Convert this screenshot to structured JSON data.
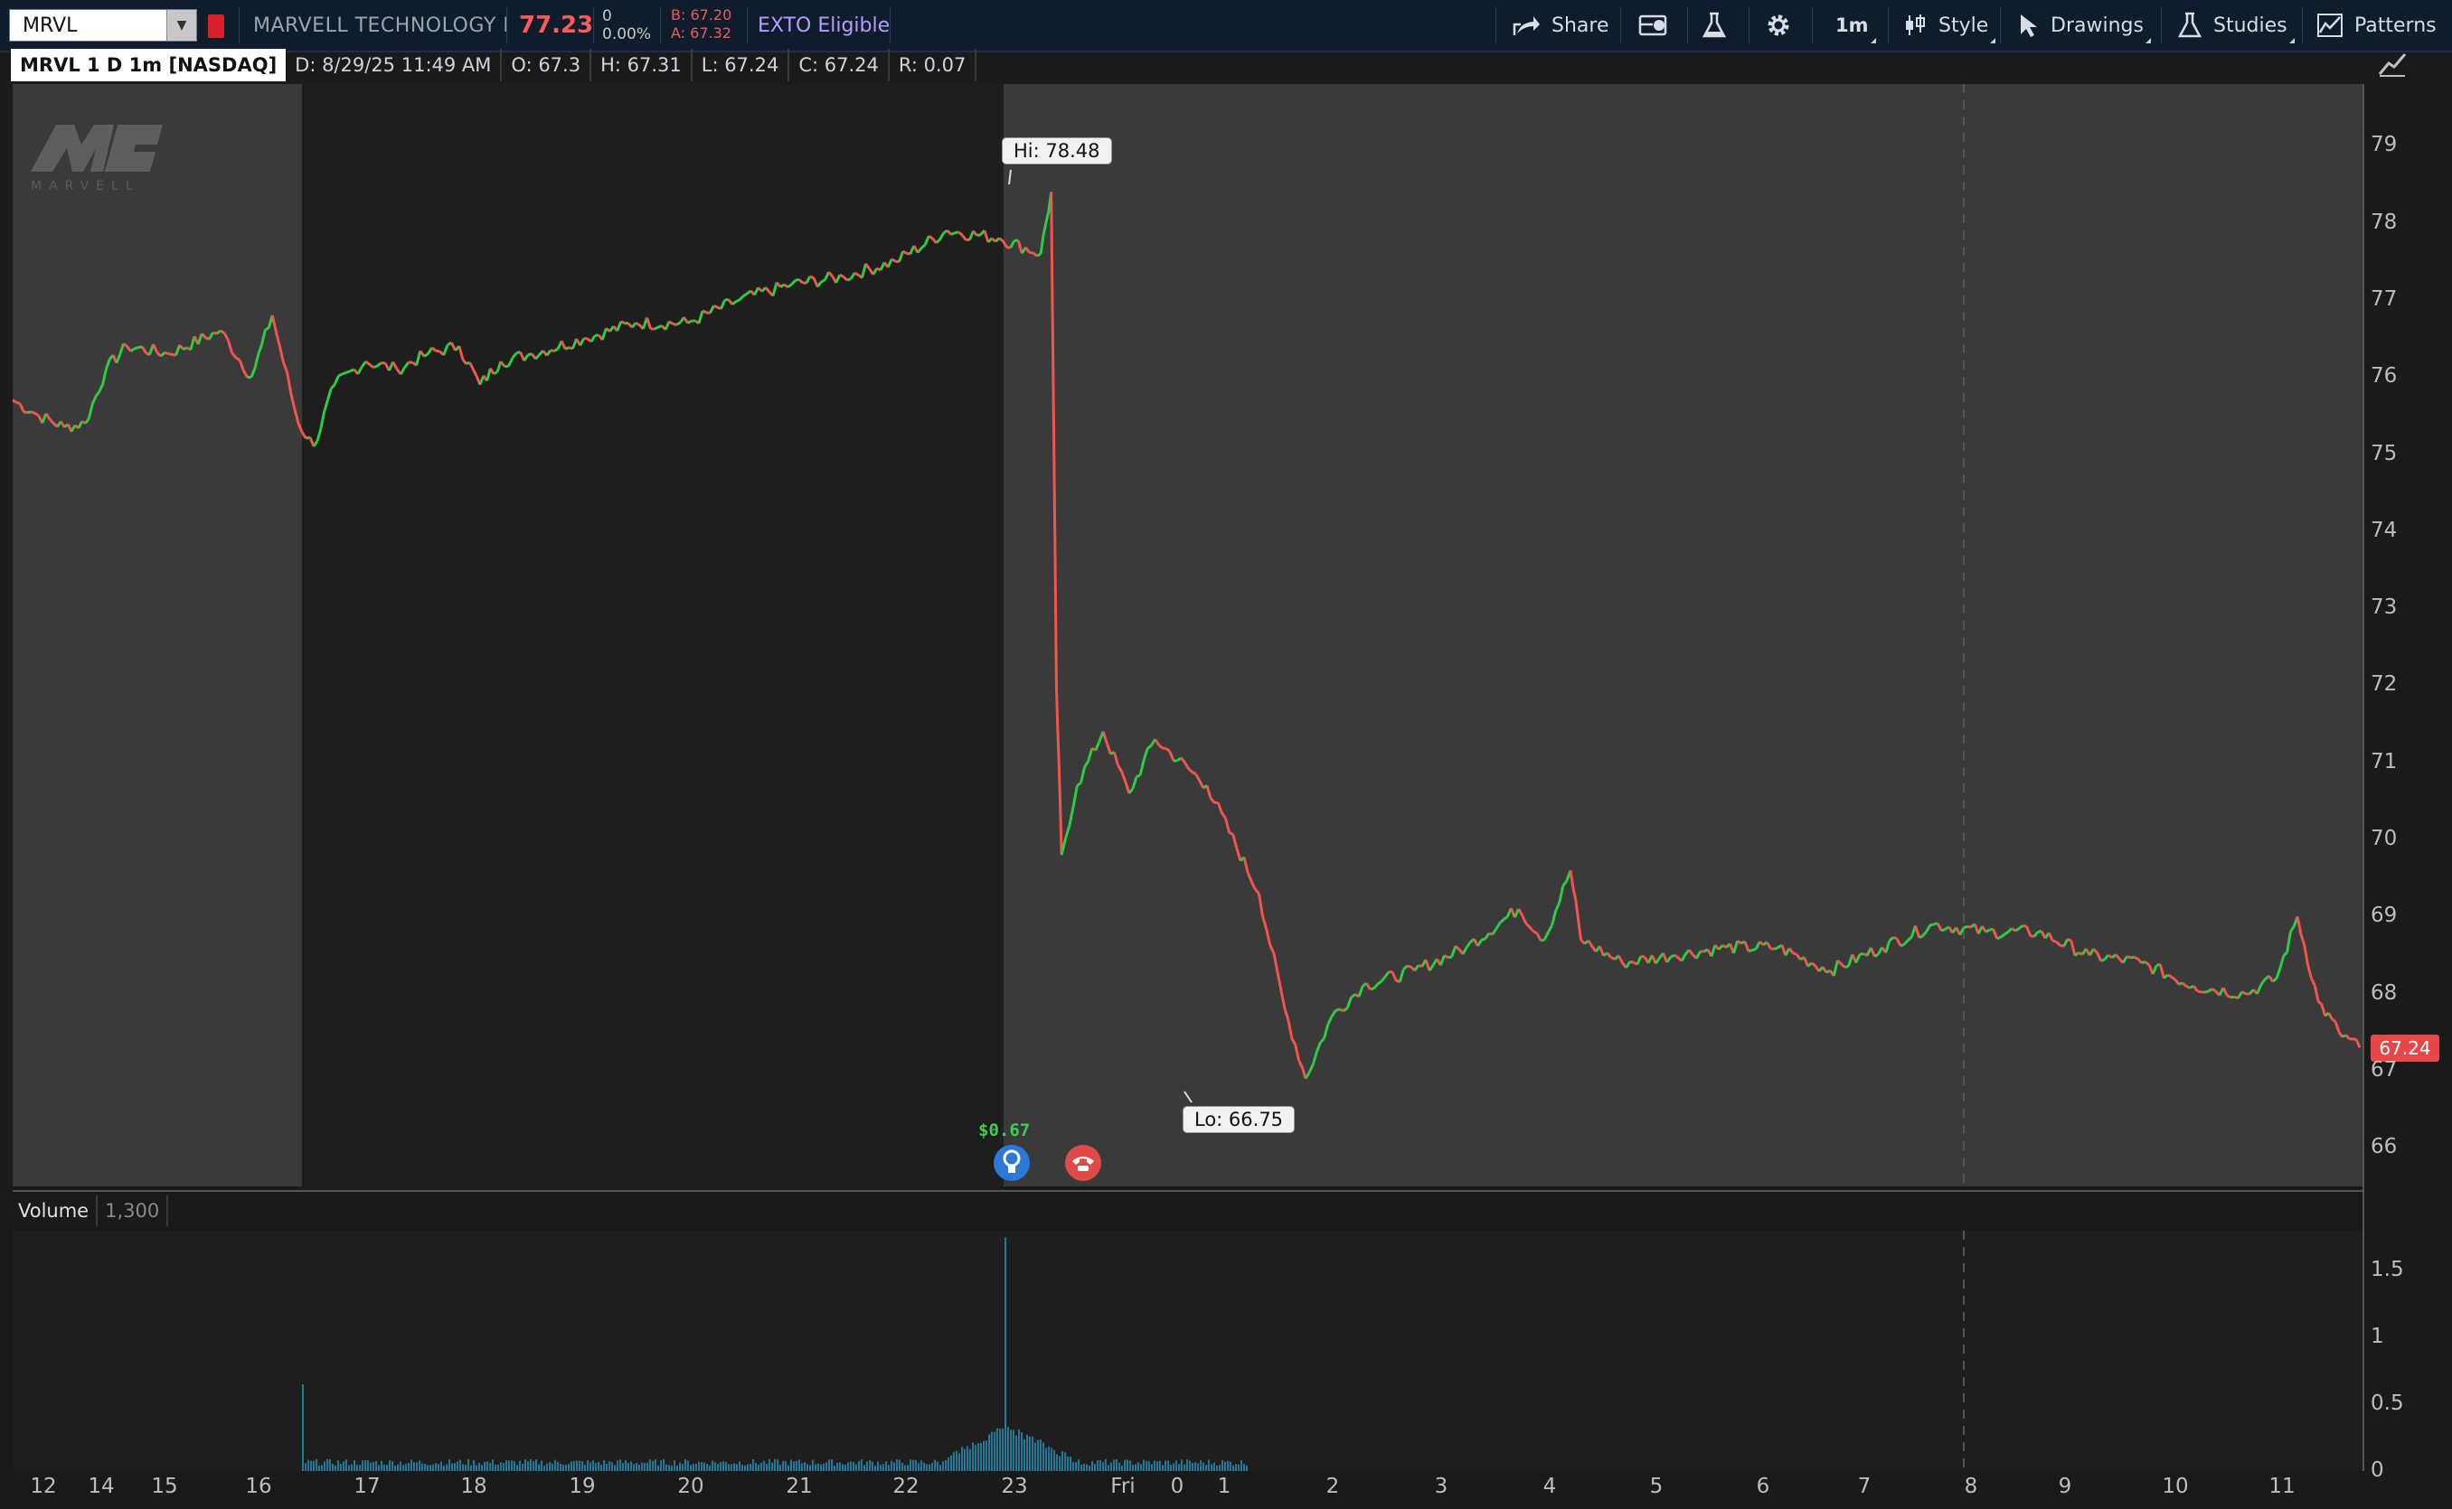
{
  "toolbar": {
    "symbol": "MRVL",
    "company": "MARVELL TECHNOLOGY I",
    "last_price": "77.23",
    "change": "0",
    "change_pct": "0.00%",
    "bid": "B: 67.20",
    "ask": "A: 67.32",
    "exto": "EXTO Eligible",
    "share_label": "Share",
    "timeframe_label": "1m",
    "style_label": "Style",
    "drawings_label": "Drawings",
    "studies_label": "Studies",
    "patterns_label": "Patterns"
  },
  "info": {
    "ticker_desc": "MRVL 1 D 1m [NASDAQ]",
    "date": "D: 8/29/25 11:49 AM",
    "open": "O: 67.3",
    "high": "H: 67.31",
    "low": "L: 67.24",
    "close": "C: 67.24",
    "range": "R: 0.07"
  },
  "chart": {
    "current_price_tag": "67.24",
    "hi_callout": "Hi: 78.48",
    "lo_callout": "Lo: 66.75",
    "earnings_value": "$0.67",
    "logo_text": "MARVELL",
    "volume_label": "Volume",
    "volume_value": "1,300",
    "colors": {
      "up": "#2ecc40",
      "down": "#f2554f",
      "volume": "#1f7a9a",
      "price_tag": "#e8474a"
    }
  },
  "chart_data": {
    "type": "line",
    "title": "MRVL 1 D 1m [NASDAQ]",
    "price_axis_ticks": [
      "79",
      "78",
      "77",
      "76",
      "75",
      "74",
      "73",
      "72",
      "71",
      "70",
      "69",
      "68",
      "67",
      "66"
    ],
    "volume_axis_ticks": [
      "1.5",
      "1",
      "0.5",
      "0"
    ],
    "x_ticks": [
      "12",
      "14",
      "15",
      "16",
      "17",
      "18",
      "19",
      "20",
      "21",
      "22",
      "23",
      "Fri",
      "0",
      "1",
      "2",
      "3",
      "4",
      "5",
      "6",
      "7",
      "8",
      "9",
      "10",
      "11"
    ],
    "ylim": [
      65.5,
      79.8
    ],
    "series": [
      {
        "values": [
          [
            0,
            75.7
          ],
          [
            0.5,
            75.5
          ],
          [
            1,
            75.35
          ],
          [
            1.4,
            75.4
          ],
          [
            1.8,
            76.1
          ],
          [
            2.2,
            76.4
          ],
          [
            3,
            76.3
          ],
          [
            4,
            76.6
          ],
          [
            4.6,
            76.0
          ],
          [
            5,
            76.8
          ],
          [
            5.5,
            75.4
          ],
          [
            5.8,
            75.1
          ],
          [
            6.2,
            75.9
          ],
          [
            6.8,
            76.2
          ],
          [
            7.4,
            76.1
          ],
          [
            8,
            76.3
          ],
          [
            8.6,
            76.4
          ],
          [
            9,
            75.9
          ],
          [
            9.4,
            76.2
          ],
          [
            10,
            76.3
          ],
          [
            11,
            76.5
          ],
          [
            12,
            76.7
          ],
          [
            13,
            76.7
          ],
          [
            14,
            77.0
          ],
          [
            15,
            77.2
          ],
          [
            16,
            77.3
          ],
          [
            17,
            77.5
          ],
          [
            18,
            77.9
          ],
          [
            19,
            77.8
          ],
          [
            19.8,
            77.6
          ],
          [
            20,
            78.4
          ],
          [
            20.1,
            72.0
          ],
          [
            20.2,
            69.8
          ],
          [
            20.5,
            70.7
          ],
          [
            21,
            71.4
          ],
          [
            21.5,
            70.6
          ],
          [
            22,
            71.3
          ],
          [
            23,
            70.7
          ],
          [
            24,
            69.3
          ],
          [
            24.5,
            67.8
          ],
          [
            24.9,
            66.9
          ],
          [
            25.4,
            67.7
          ],
          [
            26,
            68.1
          ],
          [
            27,
            68.3
          ],
          [
            28,
            68.6
          ],
          [
            29,
            69.1
          ],
          [
            29.5,
            68.7
          ],
          [
            30,
            69.6
          ],
          [
            30.2,
            68.7
          ],
          [
            31,
            68.4
          ],
          [
            32,
            68.5
          ],
          [
            33,
            68.6
          ],
          [
            34,
            68.6
          ],
          [
            35,
            68.3
          ],
          [
            36,
            68.6
          ],
          [
            37,
            68.9
          ],
          [
            38,
            68.8
          ],
          [
            39,
            68.8
          ],
          [
            40,
            68.5
          ],
          [
            41,
            68.4
          ],
          [
            42,
            68.1
          ],
          [
            43,
            68.0
          ],
          [
            43.6,
            68.2
          ],
          [
            44,
            69.0
          ],
          [
            44.4,
            67.9
          ],
          [
            44.8,
            67.5
          ],
          [
            45.2,
            67.3
          ]
        ]
      }
    ]
  }
}
